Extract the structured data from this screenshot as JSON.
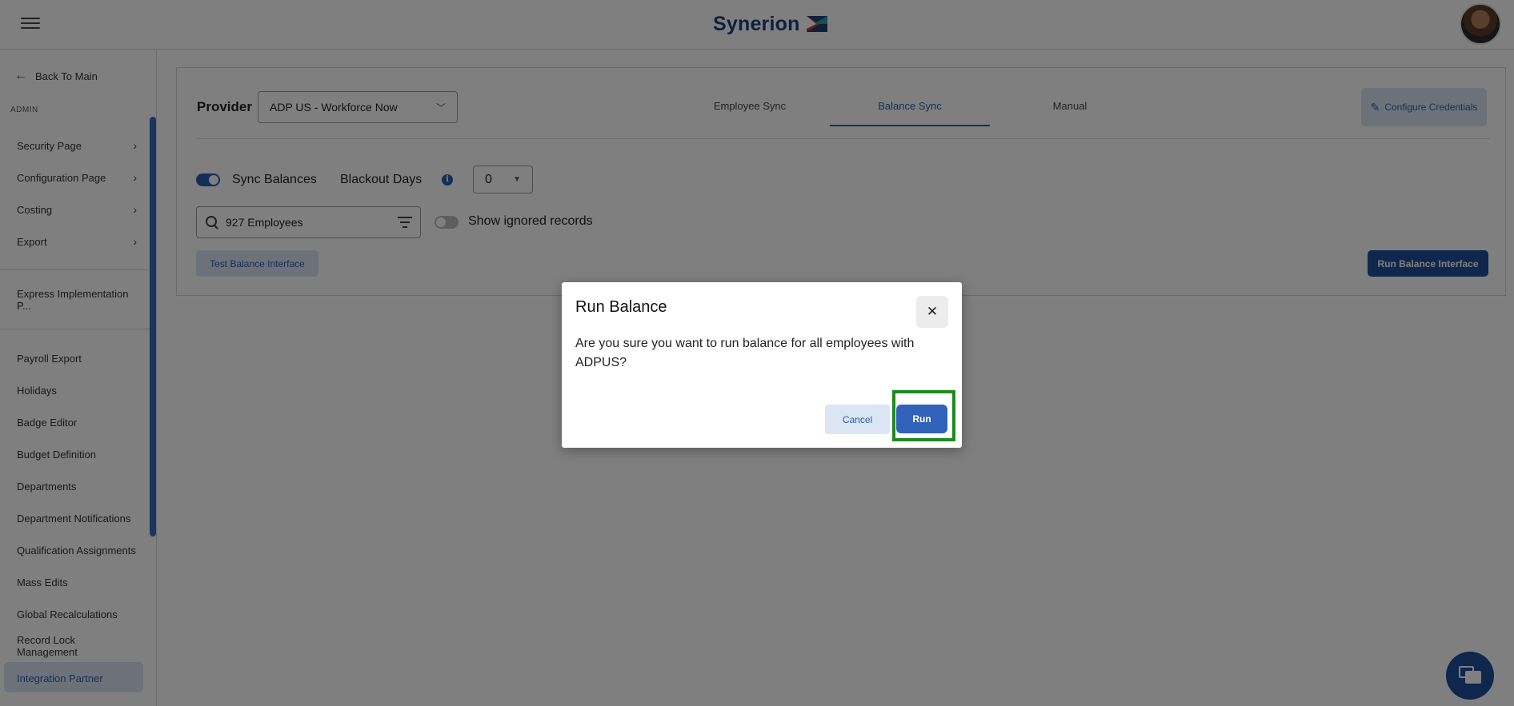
{
  "header": {
    "brand": "Synerion",
    "brand_colors": {
      "primary": "#1f3f7c",
      "accent_red": "#d9363e",
      "accent_teal": "#2aa39a"
    }
  },
  "sidebar": {
    "back_label": "Back To Main",
    "section_label": "ADMIN",
    "group1": [
      {
        "label": "Security Page",
        "chevron": "›"
      },
      {
        "label": "Configuration Page",
        "chevron": "›"
      },
      {
        "label": "Costing",
        "chevron": "›"
      },
      {
        "label": "Export",
        "chevron": "›"
      }
    ],
    "group2": [
      {
        "label": "Express Implementation P..."
      }
    ],
    "group3": [
      {
        "label": "Payroll Export"
      },
      {
        "label": "Holidays"
      },
      {
        "label": "Badge Editor"
      },
      {
        "label": "Budget Definition"
      },
      {
        "label": "Departments"
      },
      {
        "label": "Department Notifications"
      },
      {
        "label": "Qualification Assignments"
      },
      {
        "label": "Mass Edits"
      },
      {
        "label": "Global Recalculations"
      },
      {
        "label": "Record Lock Management"
      },
      {
        "label": "Integration Partner"
      }
    ],
    "active_item": "Integration Partner"
  },
  "main": {
    "provider_label": "Provider",
    "provider_value": "ADP US - Workforce Now",
    "tabs": [
      {
        "label": "Employee Sync"
      },
      {
        "label": "Balance Sync"
      },
      {
        "label": "Manual"
      }
    ],
    "active_tab": "Balance Sync",
    "configure_label": "Configure Credentials",
    "sync_label": "Sync Balances",
    "sync_on": true,
    "blackout_label": "Blackout Days",
    "blackout_value": "0",
    "search_value": "927 Employees",
    "ignored_label": "Show ignored records",
    "ignored_on": false,
    "test_button": "Test Balance Interface",
    "run_interface_button": "Run Balance Interface"
  },
  "dialog": {
    "title": "Run Balance",
    "close_glyph": "✕",
    "message": "Are you sure you want to run balance for all employees with ADPUS?",
    "cancel_label": "Cancel",
    "run_label": "Run"
  }
}
